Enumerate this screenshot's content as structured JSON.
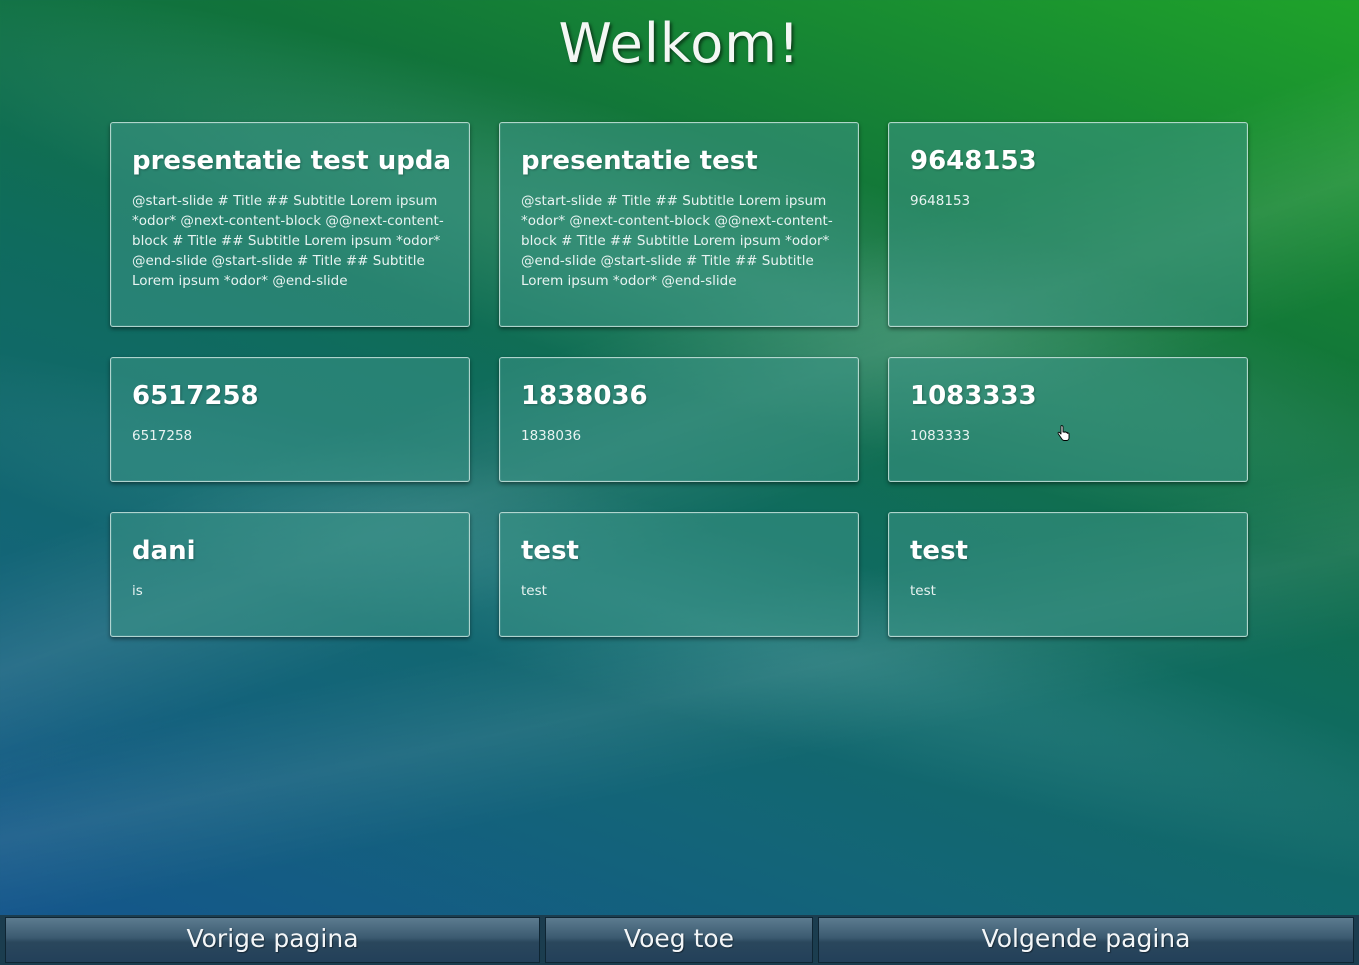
{
  "page": {
    "title": "Welkom!"
  },
  "cards": [
    {
      "title": "presentatie test upda",
      "body": "@start-slide # Title ## Subtitle Lorem ipsum *odor* @next-content-block @@next-content-block # Title ## Subtitle Lorem ipsum *odor* @end-slide @start-slide # Title ## Subtitle Lorem ipsum *odor* @end-slide"
    },
    {
      "title": "presentatie test",
      "body": "@start-slide # Title ## Subtitle Lorem ipsum *odor* @next-content-block @@next-content-block # Title ## Subtitle Lorem ipsum *odor* @end-slide @start-slide # Title ## Subtitle Lorem ipsum *odor* @end-slide"
    },
    {
      "title": "9648153",
      "body": "9648153"
    },
    {
      "title": "6517258",
      "body": "6517258"
    },
    {
      "title": "1838036",
      "body": "1838036"
    },
    {
      "title": "1083333",
      "body": "1083333"
    },
    {
      "title": "dani",
      "body": "is"
    },
    {
      "title": "test",
      "body": "test"
    },
    {
      "title": "test",
      "body": "test"
    }
  ],
  "footer": {
    "previous_label": "Vorige pagina",
    "add_label": "Voeg toe",
    "next_label": "Volgende pagina"
  },
  "icons": {
    "cursor": "hand-pointer-icon"
  }
}
